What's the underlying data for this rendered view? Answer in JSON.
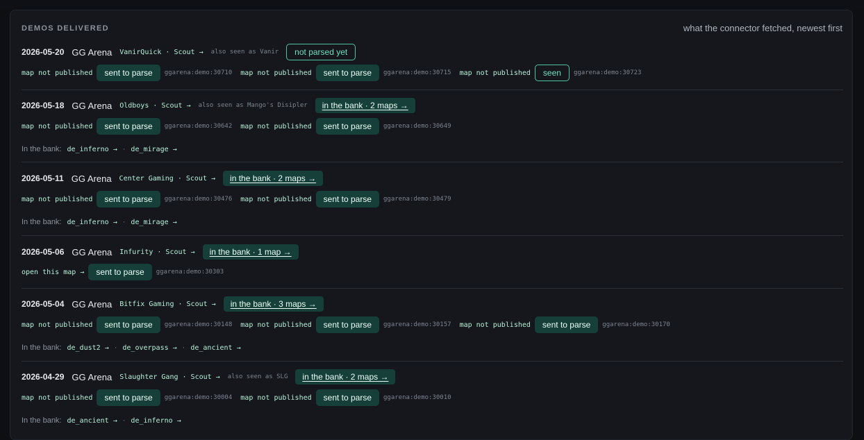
{
  "panel": {
    "title": "DEMOS DELIVERED",
    "subtitle": "what the connector fetched, newest first"
  },
  "labels": {
    "in_the_bank": "In the bank:"
  },
  "matches": [
    {
      "date": "2026-05-20",
      "event": "GG Arena",
      "opponent": "VanirQuick · Scout →",
      "also_seen": "also seen as Vanir",
      "status_pill": "not parsed yet",
      "demos": [
        {
          "status": "map not published",
          "action": "sent to parse",
          "id": "ggarena:demo:30710"
        },
        {
          "status": "map not published",
          "action": "sent to parse",
          "id": "ggarena:demo:30715"
        },
        {
          "status": "map not published",
          "action": "seen",
          "id": "ggarena:demo:30723"
        }
      ]
    },
    {
      "date": "2026-05-18",
      "event": "GG Arena",
      "opponent": "Oldboys · Scout →",
      "also_seen": "also seen as Mango's Disipler",
      "bank_pill": "in the bank · 2 maps →",
      "demos": [
        {
          "status": "map not published",
          "action": "sent to parse",
          "id": "ggarena:demo:30642"
        },
        {
          "status": "map not published",
          "action": "sent to parse",
          "id": "ggarena:demo:30649"
        }
      ],
      "bank_maps": [
        "de_inferno →",
        "de_mirage →"
      ]
    },
    {
      "date": "2026-05-11",
      "event": "GG Arena",
      "opponent": "Center Gaming · Scout →",
      "bank_pill": "in the bank · 2 maps →",
      "demos": [
        {
          "status": "map not published",
          "action": "sent to parse",
          "id": "ggarena:demo:30476"
        },
        {
          "status": "map not published",
          "action": "sent to parse",
          "id": "ggarena:demo:30479"
        }
      ],
      "bank_maps": [
        "de_inferno →",
        "de_mirage →"
      ]
    },
    {
      "date": "2026-05-06",
      "event": "GG Arena",
      "opponent": "Infurity · Scout →",
      "bank_pill": "in the bank · 1 map →",
      "demos": [
        {
          "status": "open this map →",
          "action": "sent to parse",
          "id": "ggarena:demo:30303"
        }
      ]
    },
    {
      "date": "2026-05-04",
      "event": "GG Arena",
      "opponent": "Bitfix Gaming · Scout →",
      "bank_pill": "in the bank · 3 maps →",
      "demos": [
        {
          "status": "map not published",
          "action": "sent to parse",
          "id": "ggarena:demo:30148"
        },
        {
          "status": "map not published",
          "action": "sent to parse",
          "id": "ggarena:demo:30157"
        },
        {
          "status": "map not published",
          "action": "sent to parse",
          "id": "ggarena:demo:30170"
        }
      ],
      "bank_maps": [
        "de_dust2 →",
        "de_overpass →",
        "de_ancient →"
      ]
    },
    {
      "date": "2026-04-29",
      "event": "GG Arena",
      "opponent": "Slaughter Gang · Scout →",
      "also_seen": "also seen as SLG",
      "bank_pill": "in the bank · 2 maps →",
      "demos": [
        {
          "status": "map not published",
          "action": "sent to parse",
          "id": "ggarena:demo:30004"
        },
        {
          "status": "map not published",
          "action": "sent to parse",
          "id": "ggarena:demo:30010"
        }
      ],
      "bank_maps": [
        "de_ancient →",
        "de_inferno →"
      ]
    }
  ]
}
